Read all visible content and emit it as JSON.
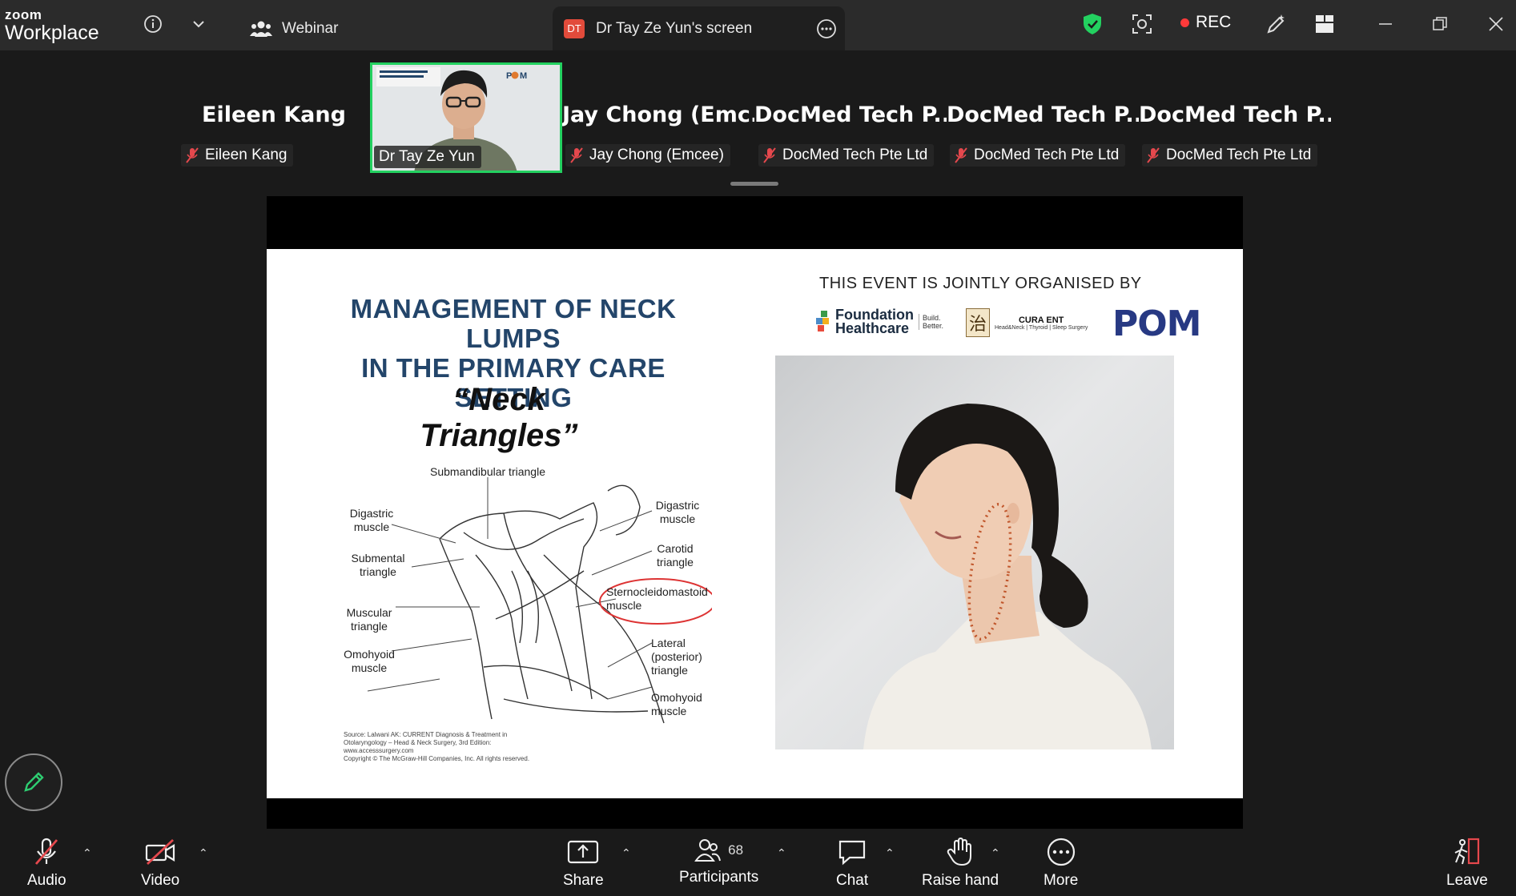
{
  "app": {
    "brand_small": "zoom",
    "brand_big": "Workplace"
  },
  "titlebar": {
    "webinar_tab": "Webinar",
    "screen_tab_badge": "DT",
    "screen_tab": "Dr Tay Ze Yun's screen",
    "rec_label": "REC"
  },
  "participants_strip": [
    {
      "big_name": "Eileen Kang",
      "label": "Eileen Kang"
    },
    {
      "big_name": "",
      "label": "Dr Tay Ze Yun"
    },
    {
      "big_name": "Jay Chong (Emc...",
      "label": "Jay Chong (Emcee)"
    },
    {
      "big_name": "DocMed Tech P...",
      "label": "DocMed Tech Pte Ltd"
    },
    {
      "big_name": "DocMed Tech P...",
      "label": "DocMed Tech Pte Ltd"
    },
    {
      "big_name": "DocMed Tech P...",
      "label": "DocMed Tech Pte Ltd"
    }
  ],
  "slide": {
    "title_line1": "MANAGEMENT OF NECK LUMPS",
    "title_line2": "IN THE PRIMARY CARE SETTING",
    "subtitle": "“Neck Triangles”",
    "organised_by": "THIS EVENT IS JOINTLY ORGANISED BY",
    "logo_foundation": "Foundation",
    "logo_healthcare": "Healthcare",
    "logo_build": "Build.",
    "logo_better": "Better.",
    "logo_cura": "CURA ENT",
    "logo_cura_sub": "Head&Neck | Thyroid | Sleep Surgery",
    "logo_pom": "POM",
    "diagram_labels": {
      "submandibular": "Submandibular triangle",
      "digastric_left": "Digastric muscle",
      "submental": "Submental triangle",
      "muscular": "Muscular triangle",
      "omohyoid_left": "Omohyoid muscle",
      "digastric_right": "Digastric muscle",
      "carotid": "Carotid triangle",
      "scm": "Sternocleidomastoid muscle",
      "lateral": "Lateral (posterior) triangle",
      "omohyoid_right": "Omohyoid muscle"
    },
    "source_line1": "Source: Lalwani AK: CURRENT Diagnosis & Treatment in",
    "source_line2": "Otolaryngology – Head & Neck Surgery, 3rd Edition:",
    "source_line3": "www.accesssurgery.com",
    "source_line4": "Copyright © The McGraw-Hill Companies, Inc. All rights reserved."
  },
  "toolbar": {
    "audio": "Audio",
    "video": "Video",
    "share": "Share",
    "participants": "Participants",
    "participants_count": "68",
    "chat": "Chat",
    "raise_hand": "Raise hand",
    "more": "More",
    "leave": "Leave"
  },
  "colors": {
    "accent_green": "#23d160",
    "rec_red": "#ff3a3a",
    "leave_red": "#e5484d",
    "slide_title": "#23456a"
  }
}
